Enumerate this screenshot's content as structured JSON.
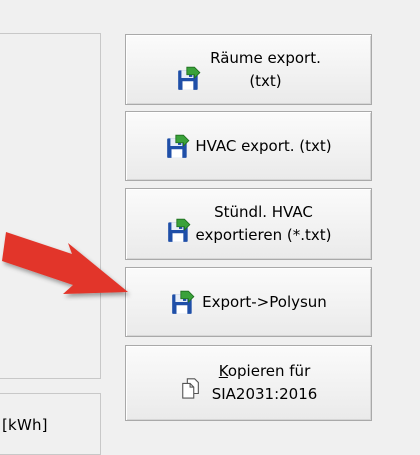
{
  "colors": {
    "background": "#f0f0f0",
    "arrow": "#e2362a",
    "floppy_body": "#1f4fa8",
    "floppy_label": "#ffffff",
    "green_arrow": "#3aa23a"
  },
  "left_panel": {
    "bottom_frame_text": "[kWh]"
  },
  "buttons": {
    "raeume": {
      "line1": "Räume export.",
      "line2": "(txt)",
      "icon": "floppy-export-icon"
    },
    "hvac": {
      "label": "HVAC export. (txt)",
      "icon": "floppy-export-icon"
    },
    "stuendl": {
      "line1": "Stündl. HVAC",
      "line2": "exportieren (*.txt)",
      "icon": "floppy-export-icon"
    },
    "polysun": {
      "label": "Export->Polysun",
      "icon": "floppy-export-icon"
    },
    "kopieren": {
      "line1_accel": "K",
      "line1_rest": "opieren für",
      "line2": "SIA2031:2016",
      "icon": "copy-document-icon"
    }
  },
  "annotation": {
    "icon": "red-pointer-arrow"
  }
}
